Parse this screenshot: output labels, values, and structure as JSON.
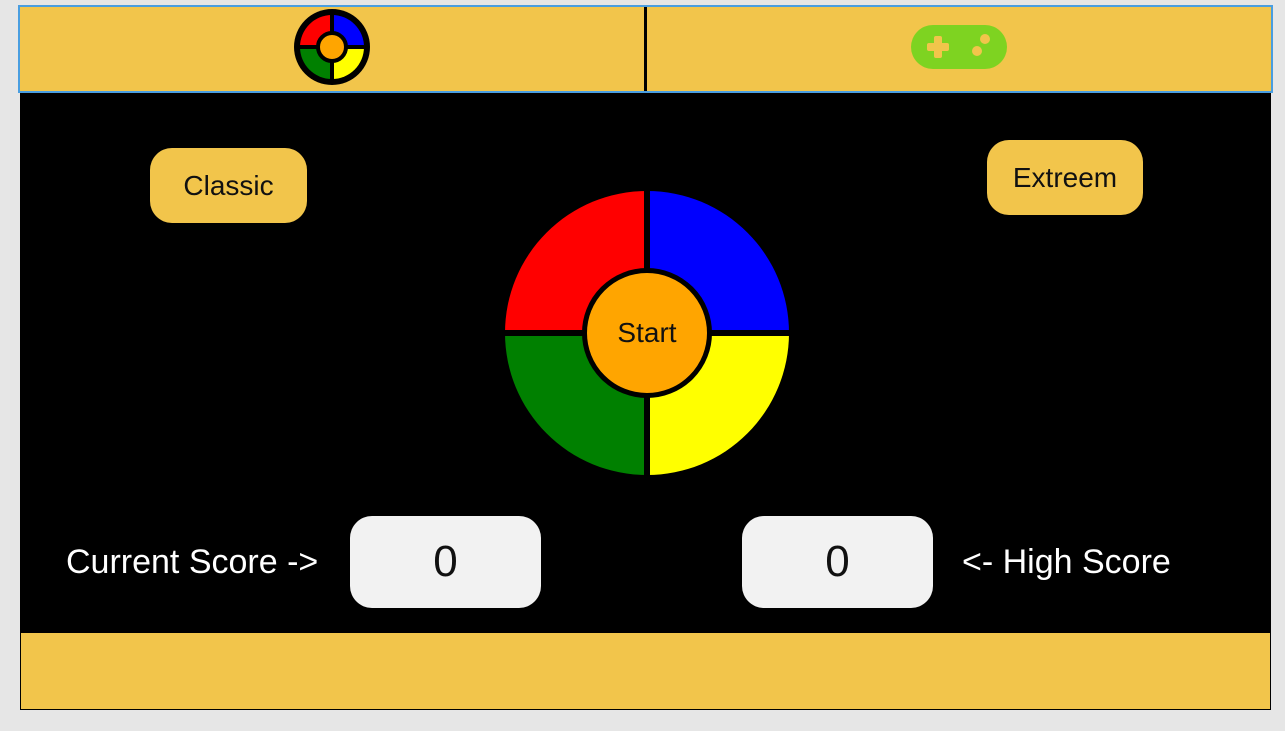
{
  "tabs": [
    {
      "name": "simon-logo-icon"
    },
    {
      "name": "gamepad-icon"
    }
  ],
  "modes": {
    "classic_label": "Classic",
    "extreem_label": "Extreem"
  },
  "board": {
    "start_label": "Start",
    "colors": {
      "top_left": "#ff0000",
      "top_right": "#0000ff",
      "bottom_left": "#008000",
      "bottom_right": "#ffff00",
      "center": "#ffa500"
    }
  },
  "scores": {
    "current_label": "Current Score ->",
    "current_value": "0",
    "high_label": "<- High Score",
    "high_value": "0"
  },
  "theme": {
    "bar_color": "#f2c54b",
    "gamepad_color": "#7ed321"
  }
}
